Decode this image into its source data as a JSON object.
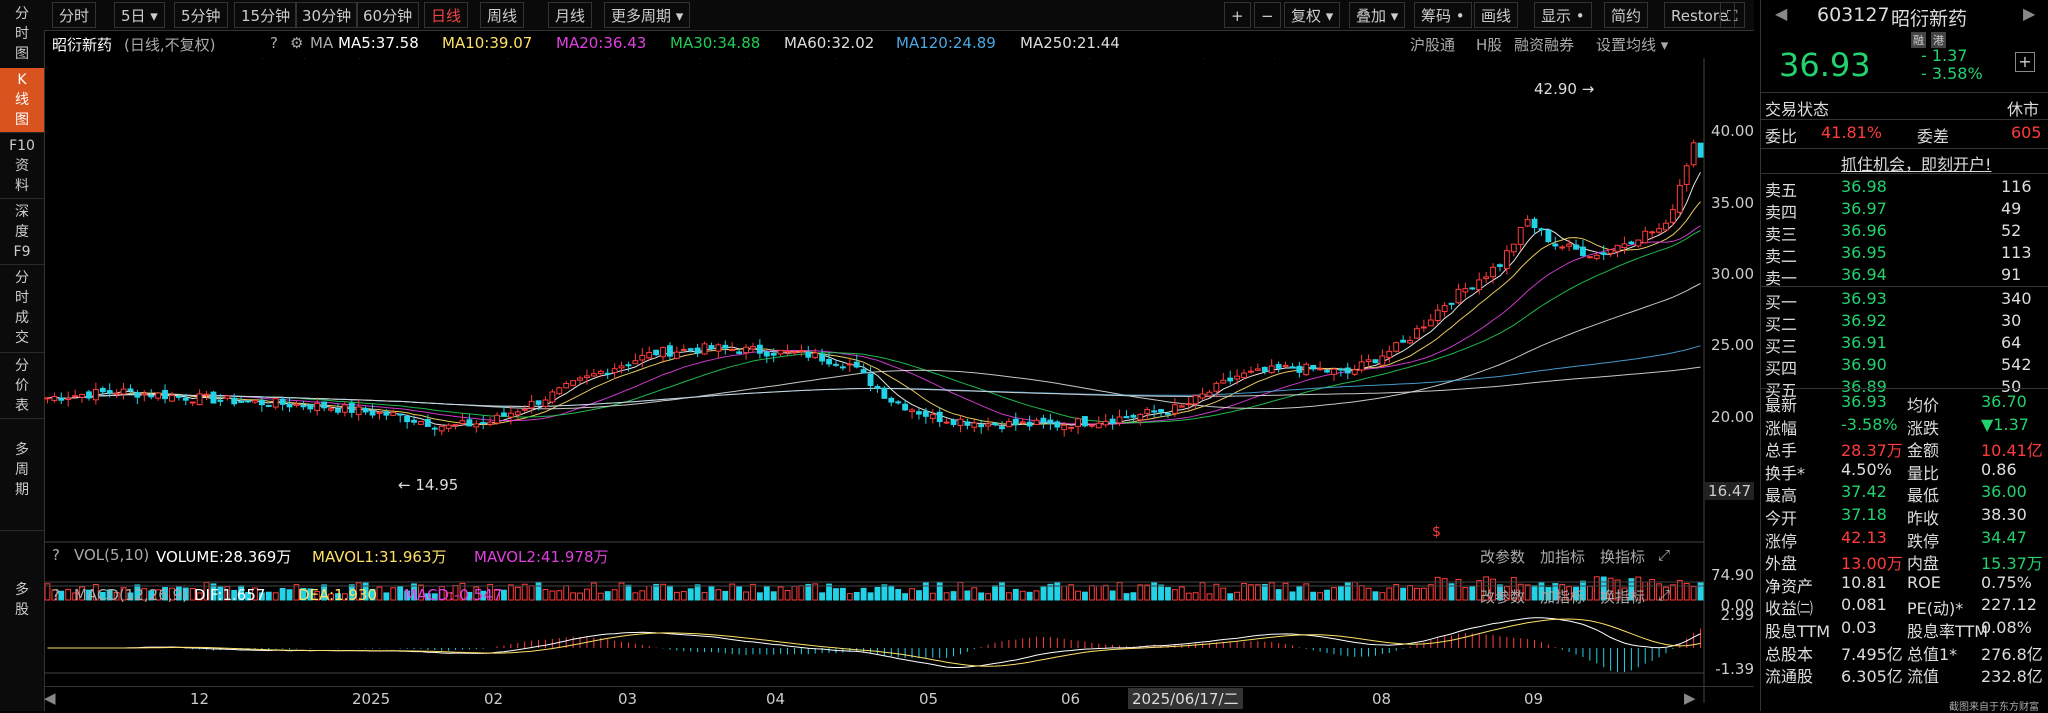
{
  "side_tabs": [
    "分\n时\n图",
    "K\n线\n图",
    "F10\n资\n料",
    "深\n度\nF9",
    "分\n时\n成\n交",
    "分\n价\n表",
    "多\n周\n期",
    "多\n股"
  ],
  "toolbar": {
    "items": [
      "分时",
      "5日 ▾",
      "5分钟",
      "15分钟",
      "30分钟",
      "60分钟",
      "日线",
      "周线",
      "月线",
      "更多周期 ▾"
    ],
    "right": [
      "+",
      "−",
      "复权 ▾",
      "叠加 ▾",
      "筹码 •",
      "画线",
      "显示 •",
      "简约",
      "Restore",
      "⛶"
    ]
  },
  "info": {
    "name": "昭衍新药",
    "mode": "(日线,不复权)",
    "ma_label": "MA",
    "ma5": "MA5:37.58",
    "ma10": "MA10:39.07",
    "ma20": "MA20:36.43",
    "ma30": "MA30:34.88",
    "ma60": "MA60:32.02",
    "ma120": "MA120:24.89",
    "ma250": "MA250:21.44",
    "links": [
      "沪股通",
      "H股",
      "融资融券",
      "设置均线 ▾"
    ]
  },
  "price_axis": [
    "40.00",
    "35.00",
    "30.00",
    "25.00",
    "20.00",
    "16.47"
  ],
  "annotations": {
    "high": "42.90",
    "low": "14.95"
  },
  "vol": {
    "label": "VOL(5,10)",
    "volume": "VOLUME:28.369万",
    "mavol1": "MAVOL1:31.963万",
    "mavol2": "MAVOL2:41.978万",
    "axis_top": "74.90",
    "axis_bot": "0.00",
    "btns": [
      "改参数",
      "加指标",
      "换指标"
    ]
  },
  "macd": {
    "label": "MACD(12,26,9)",
    "dif": "DIF:1.657",
    "dea": "DEA:1.930",
    "macd": "MACD:-0.547",
    "axis_top": "2.99",
    "axis_bot": "-1.39",
    "btns": [
      "改参数",
      "加指标",
      "换指标"
    ]
  },
  "date_axis": {
    "labels": [
      "12",
      "2025",
      "02",
      "03",
      "04",
      "05",
      "06",
      "08",
      "09"
    ],
    "cursor": "2025/06/17/二"
  },
  "right_panel": {
    "code": "603127",
    "name": "昭衍新药",
    "badges": [
      "融",
      "港"
    ],
    "price": "36.93",
    "change": "- 1.37",
    "pct": "- 3.58%",
    "status_label": "交易状态",
    "status": "休市",
    "wb_label": "委比",
    "wb": "41.81%",
    "wc_label": "委差",
    "wc": "605",
    "banner": "抓住机会，即刻开户!",
    "asks": [
      [
        "卖五",
        "36.98",
        "116"
      ],
      [
        "卖四",
        "36.97",
        "49"
      ],
      [
        "卖三",
        "36.96",
        "52"
      ],
      [
        "卖二",
        "36.95",
        "113"
      ],
      [
        "卖一",
        "36.94",
        "91"
      ]
    ],
    "bids": [
      [
        "买一",
        "36.93",
        "340"
      ],
      [
        "买二",
        "36.92",
        "30"
      ],
      [
        "买三",
        "36.91",
        "64"
      ],
      [
        "买四",
        "36.90",
        "542"
      ],
      [
        "买五",
        "36.89",
        "50"
      ]
    ],
    "stats": [
      [
        "最新",
        "36.93",
        "均价",
        "36.70"
      ],
      [
        "涨幅",
        "-3.58%",
        "涨跌",
        "▼1.37"
      ],
      [
        "总手",
        "28.37万",
        "金额",
        "10.41亿"
      ],
      [
        "换手*",
        "4.50%",
        "量比",
        "0.86"
      ],
      [
        "最高",
        "37.42",
        "最低",
        "36.00"
      ],
      [
        "今开",
        "37.18",
        "昨收",
        "38.30"
      ],
      [
        "涨停",
        "42.13",
        "跌停",
        "34.47"
      ],
      [
        "外盘",
        "13.00万",
        "内盘",
        "15.37万"
      ],
      [
        "净资产",
        "10.81",
        "ROE",
        "0.75%"
      ],
      [
        "收益㈡",
        "0.081",
        "PE(动)*",
        "227.12"
      ],
      [
        "股息TTM",
        "0.03",
        "股息率TTM",
        "0.08%"
      ],
      [
        "总股本",
        "7.495亿",
        "总值1*",
        "276.8亿"
      ],
      [
        "流通股",
        "6.305亿",
        "流值",
        "232.8亿"
      ]
    ],
    "watermark": "截图来自于东方财富"
  },
  "colors": {
    "up": "#ff3b3b",
    "down": "#22d2e6",
    "ma5": "#ffffff",
    "ma10": "#ffe066",
    "ma20": "#e040e0",
    "ma30": "#22cc55",
    "ma60": "#dddddd",
    "ma120": "#4aa8e0",
    "ma250": "#dddddd"
  }
}
